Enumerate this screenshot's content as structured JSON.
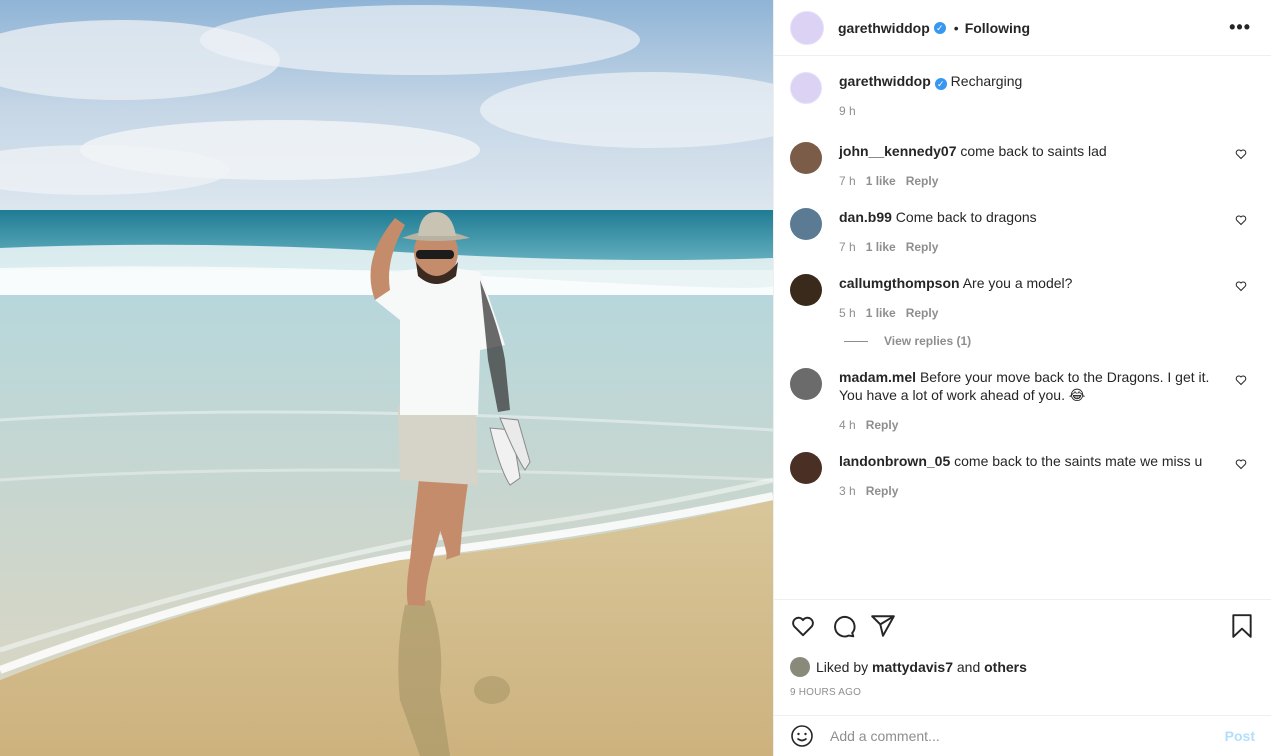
{
  "header": {
    "username": "garethwiddop",
    "verified_mark": "✓",
    "dot": "•",
    "follow_label": "Following",
    "more_icon": "more-horizontal-icon",
    "more_text": "•••"
  },
  "caption": {
    "username": "garethwiddop",
    "text": "Recharging",
    "time": "9 h"
  },
  "comments": [
    {
      "username": "john__kennedy07",
      "text": "come back to saints lad",
      "time": "7 h",
      "likes": "1 like",
      "reply": "Reply",
      "avatar_color": "#7a5c48"
    },
    {
      "username": "dan.b99",
      "text": "Come back to dragons",
      "time": "7 h",
      "likes": "1 like",
      "reply": "Reply",
      "avatar_color": "#5b7a93"
    },
    {
      "username": "callumgthompson",
      "text": "Are you a model?",
      "time": "5 h",
      "likes": "1 like",
      "reply": "Reply",
      "avatar_color": "#3a2a1c"
    },
    {
      "username": "madam.mel",
      "text": "Before your move back to the Dragons. I get it. You have a lot of work ahead of you. 😂",
      "time": "4 h",
      "reply": "Reply",
      "avatar_color": "#6b6b6b"
    },
    {
      "username": "landonbrown_05",
      "text": "come back to the saints mate we miss u",
      "time": "3 h",
      "reply": "Reply",
      "avatar_color": "#4a3024"
    }
  ],
  "view_replies": "View replies (1)",
  "actions": {
    "like_icon": "heart-icon",
    "comment_icon": "comment-icon",
    "share_icon": "share-icon",
    "save_icon": "bookmark-icon"
  },
  "likes": {
    "prefix": "Liked by",
    "user": "mattydavis7",
    "and": "and",
    "others": "others"
  },
  "timestamp": "9 HOURS AGO",
  "add_comment": {
    "placeholder": "Add a comment...",
    "post_label": "Post",
    "emoji_icon": "smiley-icon"
  },
  "colors": {
    "accent": "#3897f0",
    "post_disabled": "#b2dffc",
    "muted": "#8e8e8e"
  }
}
